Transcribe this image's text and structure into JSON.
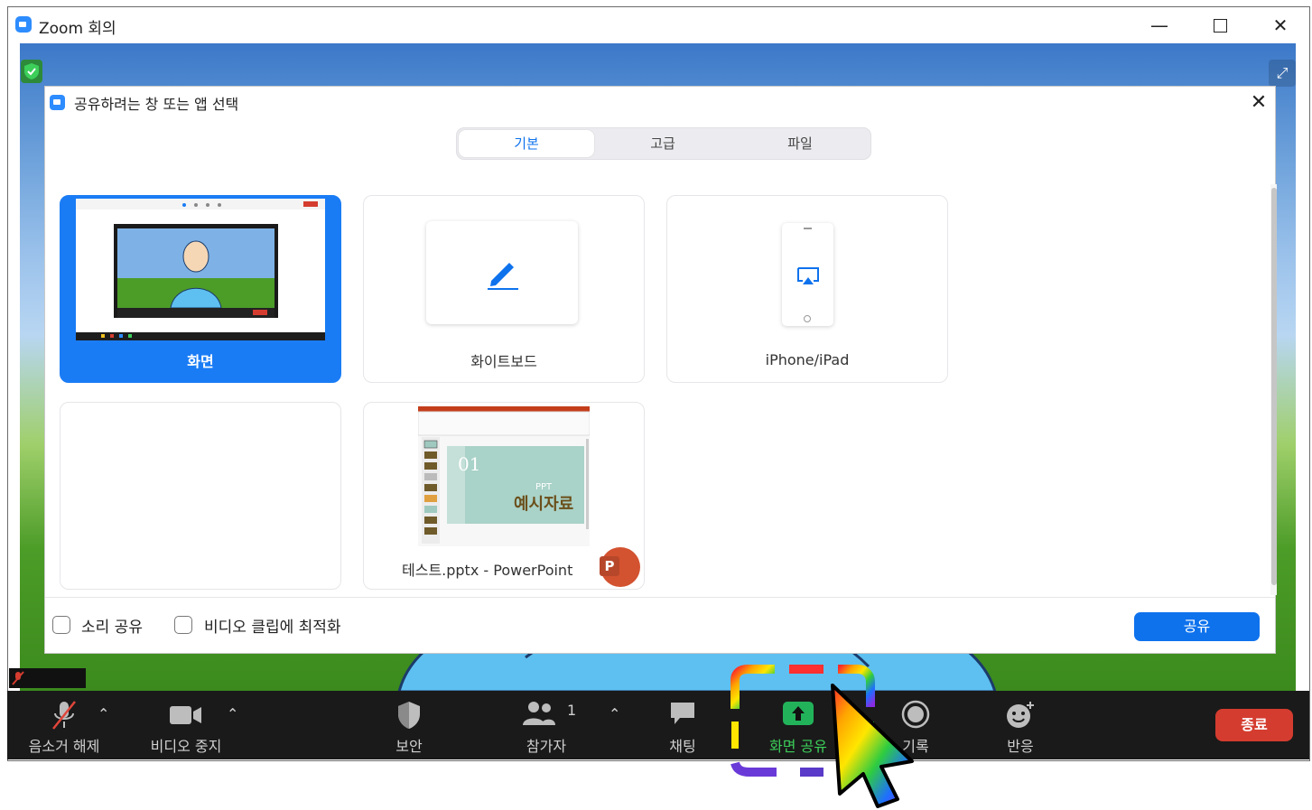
{
  "window": {
    "title": "Zoom 회의"
  },
  "dialog": {
    "title": "공유하려는 창 또는 앱 선택",
    "tabs": [
      {
        "label": "기본",
        "active": true
      },
      {
        "label": "고급",
        "active": false
      },
      {
        "label": "파일",
        "active": false
      }
    ],
    "items": [
      {
        "label": "화면",
        "selected": true
      },
      {
        "label": "화이트보드",
        "selected": false
      },
      {
        "label": "iPhone/iPad",
        "selected": false
      },
      {
        "label": "",
        "selected": false
      },
      {
        "label": "테스트.pptx - PowerPoint",
        "selected": false
      }
    ],
    "ppt_thumb": {
      "slide_number": "01",
      "small_text": "PPT",
      "big_text": "예시자료"
    },
    "ppt_badge": "P",
    "options": [
      {
        "label": "소리 공유",
        "checked": false
      },
      {
        "label": "비디오 클립에 최적화",
        "checked": false
      }
    ],
    "share_button": "공유"
  },
  "toolbar": {
    "items": [
      {
        "label": "음소거 해제"
      },
      {
        "label": "비디오 중지"
      },
      {
        "label": "보안"
      },
      {
        "label": "참가자",
        "count": "1"
      },
      {
        "label": "채팅"
      },
      {
        "label": "화면 공유"
      },
      {
        "label": "기록"
      },
      {
        "label": "반응"
      }
    ],
    "end_button": "종료"
  },
  "colors": {
    "accent": "#0e72ed",
    "selected_card": "#1a7cf5",
    "share_green": "#22b35a",
    "end_red": "#d43c2f"
  }
}
